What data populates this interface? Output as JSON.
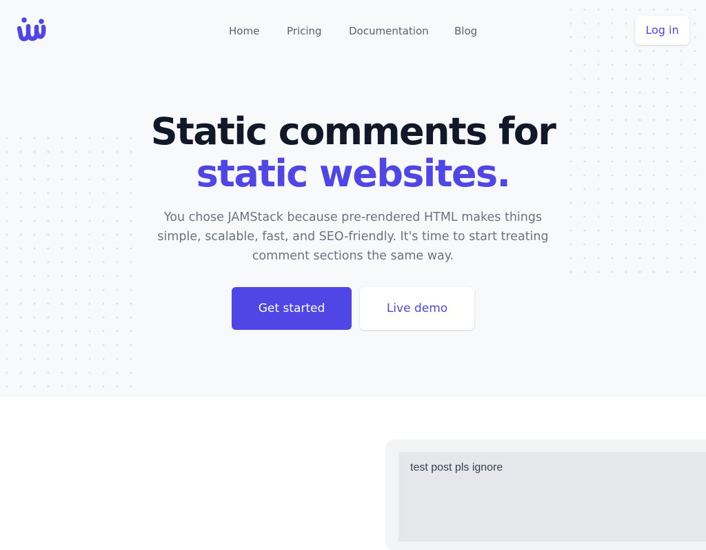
{
  "colors": {
    "accent": "#4f46e5",
    "heading": "#111827",
    "muted": "#6b7280",
    "hero_bg": "#f8f9fb"
  },
  "logo": {
    "icon": "brand-w-logo-icon"
  },
  "nav": {
    "items": [
      {
        "label": "Home"
      },
      {
        "label": "Pricing"
      },
      {
        "label": "Documentation"
      },
      {
        "label": "Blog"
      }
    ],
    "login_label": "Log in"
  },
  "hero": {
    "headline_line1": "Static comments for",
    "headline_line2": "static websites.",
    "subtitle": "You chose JAMStack because pre-rendered HTML makes things simple, scalable, fast, and SEO-friendly. It's time to start treating comment sections the same way.",
    "primary_cta": "Get started",
    "secondary_cta": "Live demo"
  },
  "demo": {
    "comment_text": "test post pls ignore"
  }
}
